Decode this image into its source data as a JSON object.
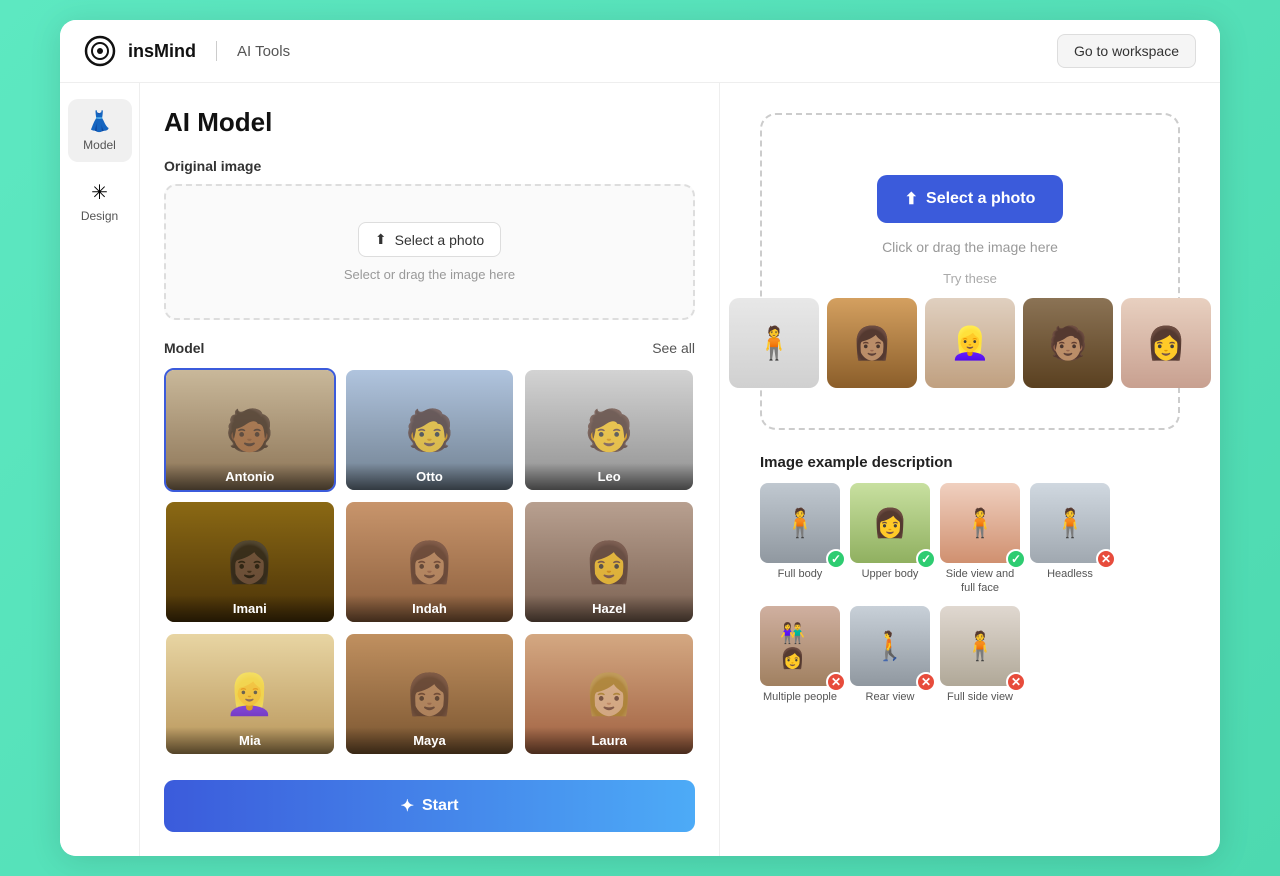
{
  "header": {
    "logo_text": "insMind",
    "separator": "|",
    "product_label": "AI Tools",
    "workspace_btn": "Go to workspace"
  },
  "sidebar": {
    "items": [
      {
        "id": "model",
        "label": "Model",
        "icon": "👗",
        "active": true
      },
      {
        "id": "design",
        "label": "Design",
        "icon": "✳",
        "active": false
      }
    ]
  },
  "left_panel": {
    "page_title": "AI Model",
    "original_image": {
      "section_title": "Original image",
      "select_btn": "Select a photo",
      "hint": "Select or drag the image here"
    },
    "model_section": {
      "title": "Model",
      "see_all": "See all",
      "models": [
        {
          "name": "Antonio",
          "color_class": "mc-antonio",
          "selected": true
        },
        {
          "name": "Otto",
          "color_class": "mc-otto",
          "selected": false
        },
        {
          "name": "Leo",
          "color_class": "mc-leo",
          "selected": false
        },
        {
          "name": "Imani",
          "color_class": "mc-imani",
          "selected": false
        },
        {
          "name": "Indah",
          "color_class": "mc-indah",
          "selected": false
        },
        {
          "name": "Hazel",
          "color_class": "mc-hazel",
          "selected": false
        },
        {
          "name": "Mia",
          "color_class": "mc-mia",
          "selected": false
        },
        {
          "name": "Maya",
          "color_class": "mc-maya",
          "selected": false
        },
        {
          "name": "Laura",
          "color_class": "mc-laura",
          "selected": false
        }
      ]
    },
    "start_btn": "Start"
  },
  "right_panel": {
    "select_photo_btn": "Select a photo",
    "drag_hint": "Click or drag the image here",
    "try_these_label": "Try these",
    "try_thumbs": [
      {
        "color_class": "tt1"
      },
      {
        "color_class": "tt2"
      },
      {
        "color_class": "tt3"
      },
      {
        "color_class": "tt4"
      },
      {
        "color_class": "tt5"
      }
    ],
    "example_section_title": "Image example description",
    "examples": [
      {
        "label": "Full body",
        "color_class": "ei1",
        "ok": true
      },
      {
        "label": "Upper body",
        "color_class": "ei2",
        "ok": true
      },
      {
        "label": "Side view and full face",
        "color_class": "ei3",
        "ok": true
      },
      {
        "label": "Headless",
        "color_class": "ei4",
        "ok": false
      },
      {
        "label": "Multiple people",
        "color_class": "ei5",
        "ok": false
      },
      {
        "label": "Rear view",
        "color_class": "ei6",
        "ok": false
      },
      {
        "label": "Full side view",
        "color_class": "ei7",
        "ok": false
      }
    ]
  }
}
